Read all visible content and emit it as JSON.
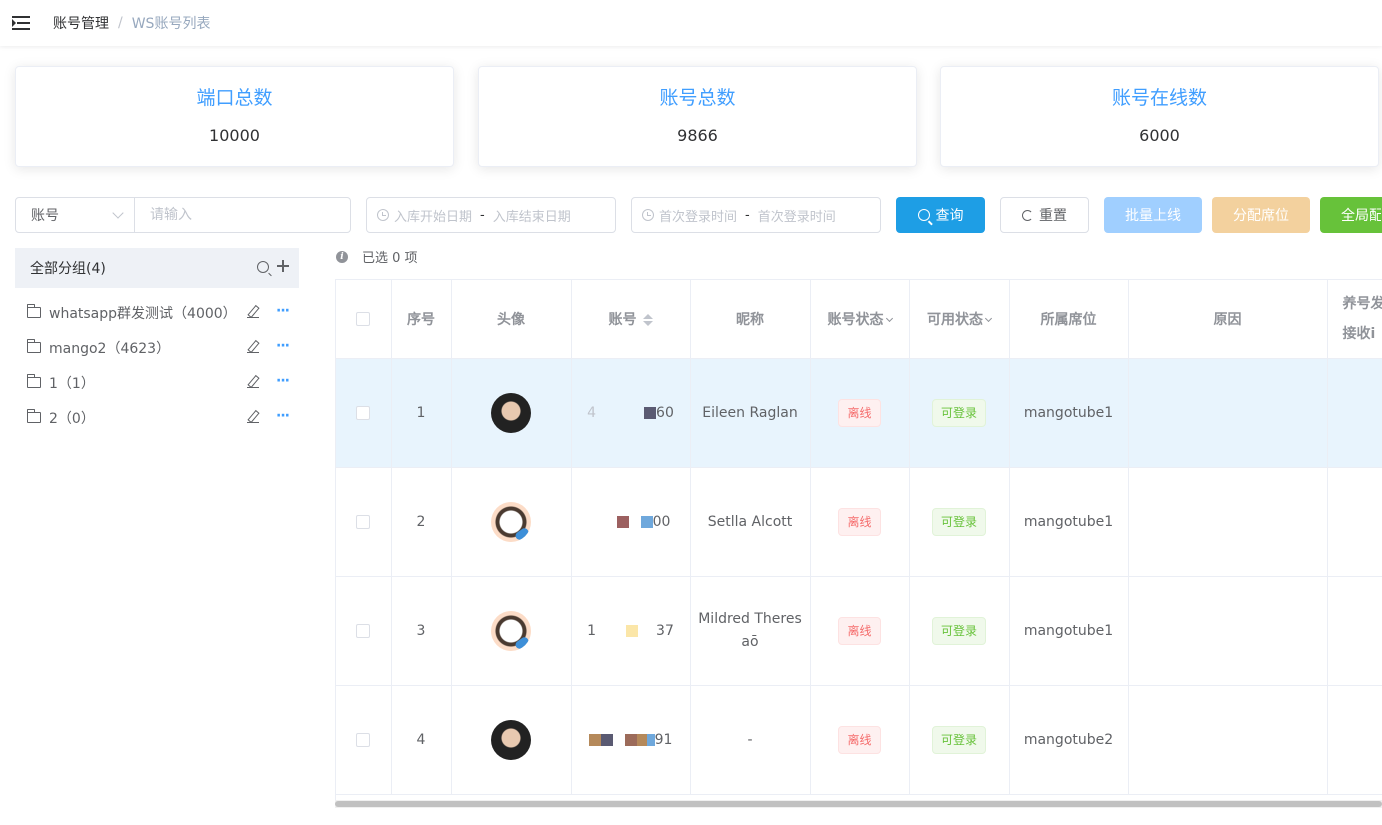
{
  "header": {
    "breadcrumb": [
      "账号管理",
      "WS账号列表"
    ],
    "separator": "/"
  },
  "stats": [
    {
      "title": "端口总数",
      "value": "10000"
    },
    {
      "title": "账号总数",
      "value": "9866"
    },
    {
      "title": "账号在线数",
      "value": "6000"
    }
  ],
  "filters": {
    "field_select": "账号",
    "text_placeholder": "请输入",
    "date1_start": "入库开始日期",
    "date1_end": "入库结束日期",
    "date2_start": "首次登录时间",
    "date2_end": "首次登录时间",
    "dash": "-"
  },
  "buttons": {
    "query": "查询",
    "reset": "重置",
    "batch_online": "批量上线",
    "assign_seat": "分配席位",
    "global_config": "全局配"
  },
  "groups": {
    "title": "全部分组(4)",
    "items": [
      {
        "label": "whatsapp群发测试（4000）"
      },
      {
        "label": "mango2（4623）"
      },
      {
        "label": "1（1）"
      },
      {
        "label": "2（0）"
      }
    ]
  },
  "selection": {
    "text": "已选 0 项"
  },
  "table": {
    "columns": [
      "序号",
      "头像",
      "账号",
      "昵称",
      "账号状态",
      "可用状态",
      "所属席位",
      "原因",
      "养号发",
      "接收i"
    ],
    "rows": [
      {
        "index": "1",
        "account_left": "4",
        "account_right": "60",
        "nickname": "Eileen Raglan",
        "status": "离线",
        "usable": "可登录",
        "seat": "mangotube1",
        "reason": ""
      },
      {
        "index": "2",
        "account_left": "",
        "account_right": "00",
        "nickname": "Setlla Alcott",
        "status": "离线",
        "usable": "可登录",
        "seat": "mangotube1",
        "reason": ""
      },
      {
        "index": "3",
        "account_left": "1",
        "account_right": "37",
        "nickname": "Mildred Theres",
        "nickname2": "aō",
        "status": "离线",
        "usable": "可登录",
        "seat": "mangotube1",
        "reason": ""
      },
      {
        "index": "4",
        "account_left": "",
        "account_right": "91",
        "nickname": "-",
        "status": "离线",
        "usable": "可登录",
        "seat": "mangotube2",
        "reason": ""
      }
    ]
  }
}
